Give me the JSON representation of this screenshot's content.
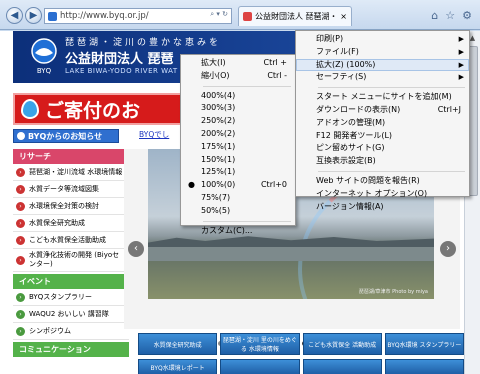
{
  "browser": {
    "url": "http://www.byq.or.jp/",
    "tab_title": "公益財団法人 琵琶湖・淀",
    "back_icon": "back-arrow-icon",
    "forward_icon": "forward-arrow-icon"
  },
  "site": {
    "header_top": "琵琶湖・淀川の豊かな恵みを",
    "org_name": "公益財団法人 琵琶",
    "org_name_en": "LAKE BIWA-YODO RIVER WAT",
    "logo_text": "BYQ",
    "donate": "ご寄付のお",
    "news_heading": "BYQからのお知らせ",
    "news_link": "BYQでし",
    "photo_credit": "琵琶湖/草津市 Photo by miya",
    "sidebar": {
      "research_heading": "リサーチ",
      "research_items": [
        "琵琶湖・淀川流域 水環境情報",
        "水質データ等流域図集",
        "水環境保全対策の検討",
        "水質保全研究助成",
        "こども水質保全活動助成",
        "水質浄化技術の開発 (Biyoセンター)"
      ],
      "event_heading": "イベント",
      "event_items": [
        "BYQスタンプラリー",
        "WAQU2 おいしい 講習隊",
        "シンポジウム"
      ],
      "communication_heading": "コミュニケーション"
    },
    "bottom_buttons": [
      "水質保全研究助成",
      "琵琶湖・淀川 里の川をめぐる 水環境情報",
      "こども水質保全 活動助成",
      "BYQ水環境 スタンプラリー"
    ],
    "bottom_buttons2": [
      "BYQ水環境レポート",
      "",
      "",
      ""
    ]
  },
  "zoom_menu": {
    "items": [
      {
        "label": "拡大(I)",
        "shortcut": "Ctrl +"
      },
      {
        "label": "縮小(O)",
        "shortcut": "Ctrl -"
      },
      {
        "sep": true
      },
      {
        "label": "400%(4)"
      },
      {
        "label": "300%(3)"
      },
      {
        "label": "250%(2)"
      },
      {
        "label": "200%(2)"
      },
      {
        "label": "175%(1)"
      },
      {
        "label": "150%(1)"
      },
      {
        "label": "125%(1)"
      },
      {
        "label": "100%(0)",
        "shortcut": "Ctrl+0",
        "selected": true
      },
      {
        "label": "75%(7)"
      },
      {
        "label": "50%(5)"
      },
      {
        "sep": true
      },
      {
        "label": "カスタム(C)..."
      }
    ]
  },
  "tools_menu": {
    "items": [
      {
        "label": "印刷(P)",
        "submenu": true
      },
      {
        "label": "ファイル(F)",
        "submenu": true
      },
      {
        "label": "拡大(Z) (100%)",
        "submenu": true,
        "highlighted": true
      },
      {
        "label": "セーフティ(S)",
        "submenu": true
      },
      {
        "sep": true
      },
      {
        "label": "スタート メニューにサイトを追加(M)"
      },
      {
        "label": "ダウンロードの表示(N)",
        "shortcut": "Ctrl+J"
      },
      {
        "label": "アドオンの管理(M)"
      },
      {
        "label": "F12 開発者ツール(L)"
      },
      {
        "label": "ピン留めサイト(G)"
      },
      {
        "label": "互換表示設定(B)"
      },
      {
        "sep": true
      },
      {
        "label": "Web サイトの問題を報告(R)"
      },
      {
        "label": "インターネット オプション(O)"
      },
      {
        "label": "バージョン情報(A)"
      }
    ]
  },
  "slider": {
    "total_dots": 15,
    "active_dot": 7
  }
}
